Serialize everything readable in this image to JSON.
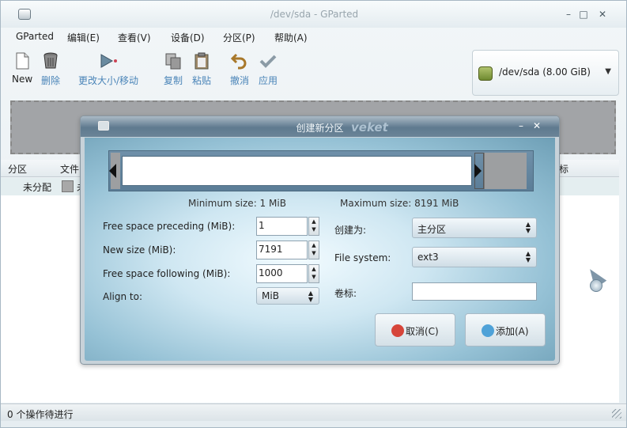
{
  "window": {
    "title": "/dev/sda - GParted",
    "minimize": "–",
    "maximize": "□",
    "close": "✕"
  },
  "menubar": {
    "items": [
      "GParted",
      "编辑(E)",
      "查看(V)",
      "设备(D)",
      "分区(P)",
      "帮助(A)"
    ]
  },
  "toolbar": {
    "new": "New",
    "delete": "删除",
    "resize_move": "更改大小/移动",
    "copy": "复制",
    "paste": "粘贴",
    "undo": "撤消",
    "apply": "应用",
    "device": "/dev/sda  (8.00 GiB)",
    "device_arrow": "▼"
  },
  "table": {
    "headers": [
      "分区",
      "文件",
      "标"
    ],
    "row": {
      "partition": "未分配",
      "fs_partial": "未"
    }
  },
  "statusbar": {
    "text": "0 个操作待进行"
  },
  "dialog": {
    "title": "创建新分区",
    "brand": "veket",
    "min_button": "–",
    "close_button": "✕",
    "min_size_label": "Minimum size: 1 MiB",
    "max_size_label": "Maximum size: 8191 MiB",
    "free_preceding_label": "Free space preceding (MiB):",
    "free_preceding_value": "1",
    "new_size_label": "New size (MiB):",
    "new_size_value": "7191",
    "free_following_label": "Free space following (MiB):",
    "free_following_value": "1000",
    "align_label": "Align to:",
    "align_value": "MiB",
    "create_as_label": "创建为:",
    "create_as_value": "主分区",
    "fs_label": "File system:",
    "fs_value": "ext3",
    "volume_label": "卷标:",
    "volume_value": "",
    "cancel": "取消(C)",
    "add": "添加(A)"
  },
  "colors": {
    "toolbar_label": "#4a84b8",
    "dialog_title_bar": "#5f7a8f",
    "unallocated": "#a2a4a7",
    "cancel_icon": "#d6453a",
    "add_icon": "#4fa2d8"
  }
}
